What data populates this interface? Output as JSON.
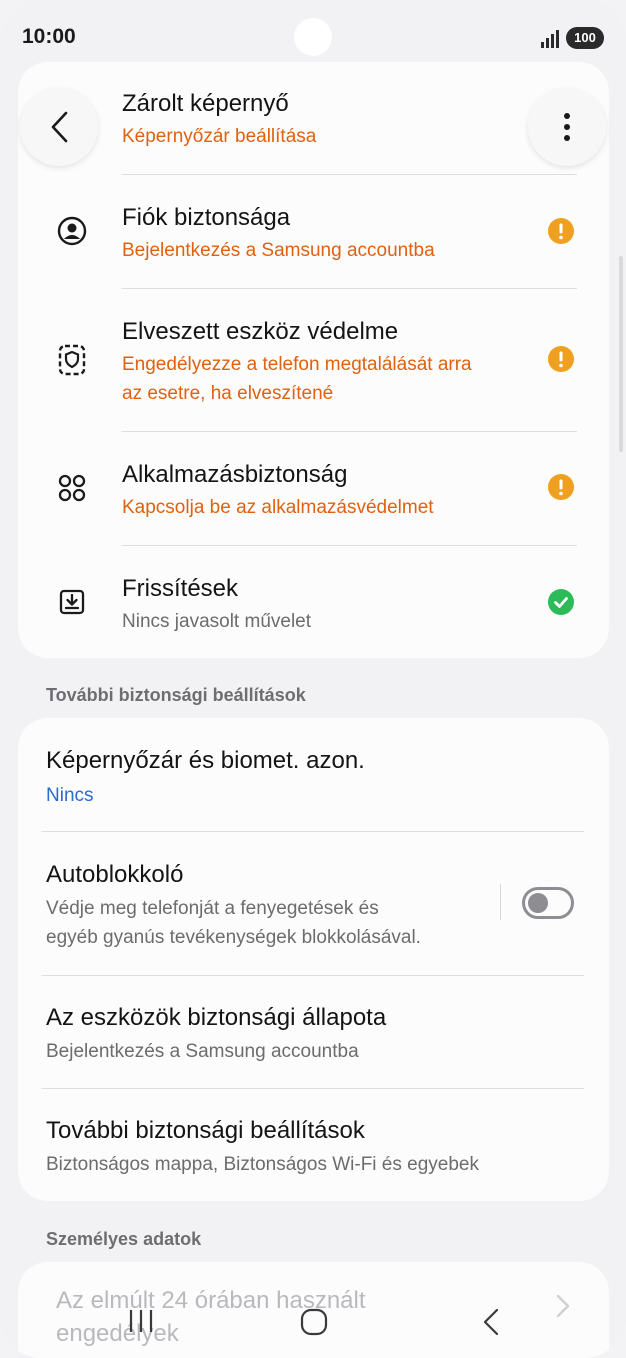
{
  "status_bar": {
    "time": "10:00",
    "battery": "100"
  },
  "header": {
    "title": "Zárolt képernyő",
    "subtitle": "Képernyőzár beállítása",
    "back_icon": "chevron-left-icon",
    "more_icon": "more-vertical-icon"
  },
  "security_items": [
    {
      "title": "Fiók biztonsága",
      "subtitle": "Bejelentkezés a Samsung accountba",
      "icon": "account-circle-icon",
      "status": "warning"
    },
    {
      "title": "Elveszett eszköz védelme",
      "subtitle_line1": "Engedélyezze a telefon megtalálását arra",
      "subtitle_line2": "az esetre, ha elveszítené",
      "icon": "shield-device-icon",
      "status": "warning"
    },
    {
      "title": "Alkalmazásbiztonság",
      "subtitle": "Kapcsolja be az alkalmazásvédelmet",
      "icon": "apps-grid-icon",
      "status": "warning"
    },
    {
      "title": "Frissítések",
      "subtitle": "Nincs javasolt művelet",
      "icon": "download-box-icon",
      "status": "ok"
    }
  ],
  "sections": {
    "more_security": "További biztonsági beállítások",
    "personal": "Személyes adatok"
  },
  "more_items": [
    {
      "title": "Képernyőzár és biomet. azon.",
      "value": "Nincs"
    },
    {
      "title": "Autoblokkoló",
      "subtitle_line1": "Védje meg telefonját a fenyegetések és",
      "subtitle_line2": "egyéb gyanús tevékenységek blokkolásával.",
      "toggle": false
    },
    {
      "title": "Az eszközök biztonsági állapota",
      "subtitle": "Bejelentkezés a Samsung accountba"
    },
    {
      "title": "További biztonsági beállítások",
      "subtitle": "Biztonságos mappa, Biztonságos Wi-Fi és egyebek"
    }
  ],
  "personal_items": [
    {
      "title_line1": "Az elmúlt 24 órában használt",
      "title_line2": "engedélyek"
    }
  ],
  "colors": {
    "warning": "#f0a020",
    "ok": "#2dbb5a",
    "orange_text": "#e0610f",
    "blue_text": "#2a6ad1"
  }
}
